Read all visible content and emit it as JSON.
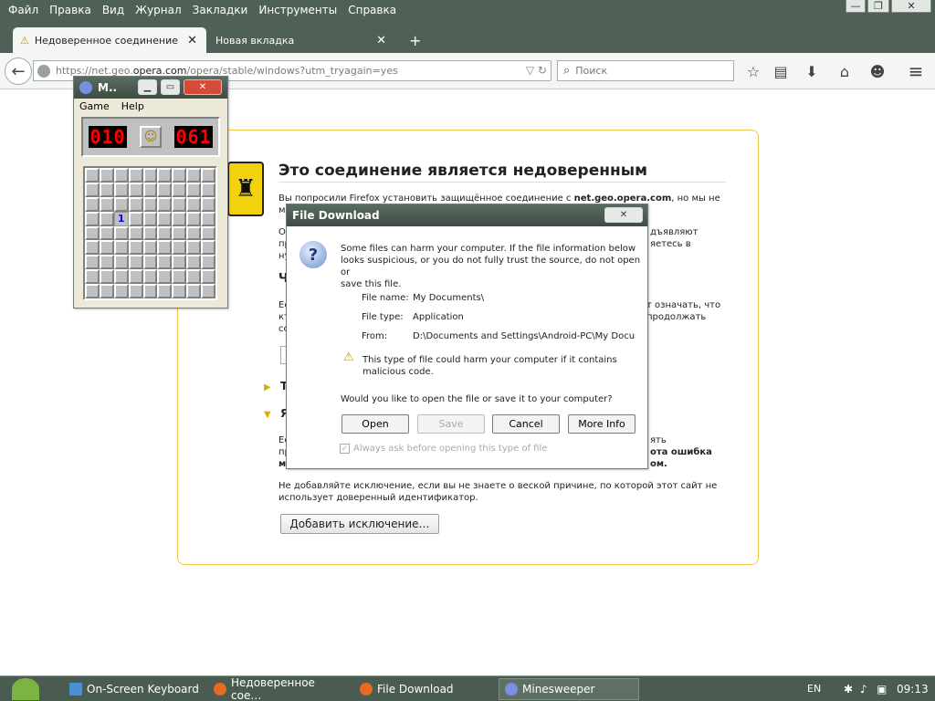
{
  "menu": [
    "Файл",
    "Правка",
    "Вид",
    "Журнал",
    "Закладки",
    "Инструменты",
    "Справка"
  ],
  "window_controls": {
    "minimize": "—",
    "restore": "❐",
    "close": "✕"
  },
  "tabs": [
    {
      "label": "Недоверенное соединение",
      "warning_icon": "⚠",
      "close": "✕"
    },
    {
      "label": "Новая вкладка",
      "close": "✕"
    }
  ],
  "new_tab": "+",
  "nav": {
    "back_arrow": "←",
    "url_prefix": "https://net.geo.",
    "url_host": "opera.com",
    "url_rest": "/opera/stable/windows?utm_tryagain=yes",
    "url_right_icons": "▽ ↻",
    "search_placeholder": "Поиск",
    "toolbar": {
      "star": "☆",
      "reader": "▤",
      "download": "⬇",
      "home": "⌂",
      "chat": "☻",
      "menu": "≡"
    }
  },
  "error_page": {
    "title": "Это соединение является недоверенным",
    "p1_a": "Вы попросили Firefox установить защищённое соединение с ",
    "p1_host": "net.geo.opera.com",
    "p1_b": ", но мы не",
    "p1_c": "мо",
    "p2_frag1": "О",
    "p2_frag2": "дъявляют",
    "p2_frag3": "пр",
    "p2_frag4": "яетесь в",
    "p2_frag5": "ну",
    "h2_frag": "Ч",
    "p3_frag1": "Ес",
    "p3_frag2": "т означать, что",
    "p3_frag3": "кт",
    "p3_frag4": "продолжать",
    "p3_frag5": "со",
    "sec1_frag": "Т",
    "sec2_frag": "Я",
    "p4_frag1": "Ес",
    "p4_frag2": "ять",
    "p4_frag3": "пр",
    "p4_frag4": "ота ошибка",
    "p4_frag5": "м",
    "p4_frag6": "ом.",
    "p5_line1": "Не добавляйте исключение, если вы не знаете о веской причине, по которой этот сайт не",
    "p5_line2": "использует доверенный идентификатор.",
    "add_exception_button": "Добавить исключение…"
  },
  "minesweeper": {
    "title": "M..",
    "menu": [
      "Game",
      "Help"
    ],
    "mine_counter": "010",
    "timer": "061",
    "smiley": "☺",
    "grid_rows": 9,
    "grid_cols": 9,
    "opened_cell": {
      "row": 3,
      "col": 2,
      "value": "1"
    }
  },
  "file_download": {
    "title": "File Download",
    "question_icon": "?",
    "message_l1": "Some files can harm your computer. If the file information below",
    "message_l2": "looks suspicious, or you do not fully trust the source, do not open or",
    "message_l3": "save this file.",
    "file_name_label": "File name:",
    "file_name_value": "My Documents\\",
    "file_type_label": "File type:",
    "file_type_value": "Application",
    "from_label": "From:",
    "from_value": "D:\\Documents and Settings\\Android-PC\\My Docum",
    "warning_icon": "⚠",
    "warning_l1": "This type of file could harm your computer if it contains",
    "warning_l2": "malicious code.",
    "prompt": "Would you like to open the file or save it to your computer?",
    "buttons": {
      "open": "Open",
      "save": "Save",
      "cancel": "Cancel",
      "more_info": "More Info"
    },
    "checkbox_label": "Always ask before opening this type of file",
    "checkbox_mark": "✓",
    "close": "✕"
  },
  "taskbar": {
    "items": [
      "On-Screen Keyboard",
      "Недоверенное сое…",
      "File Download",
      "Minesweeper"
    ],
    "lang": "EN",
    "clock": "09:13"
  }
}
